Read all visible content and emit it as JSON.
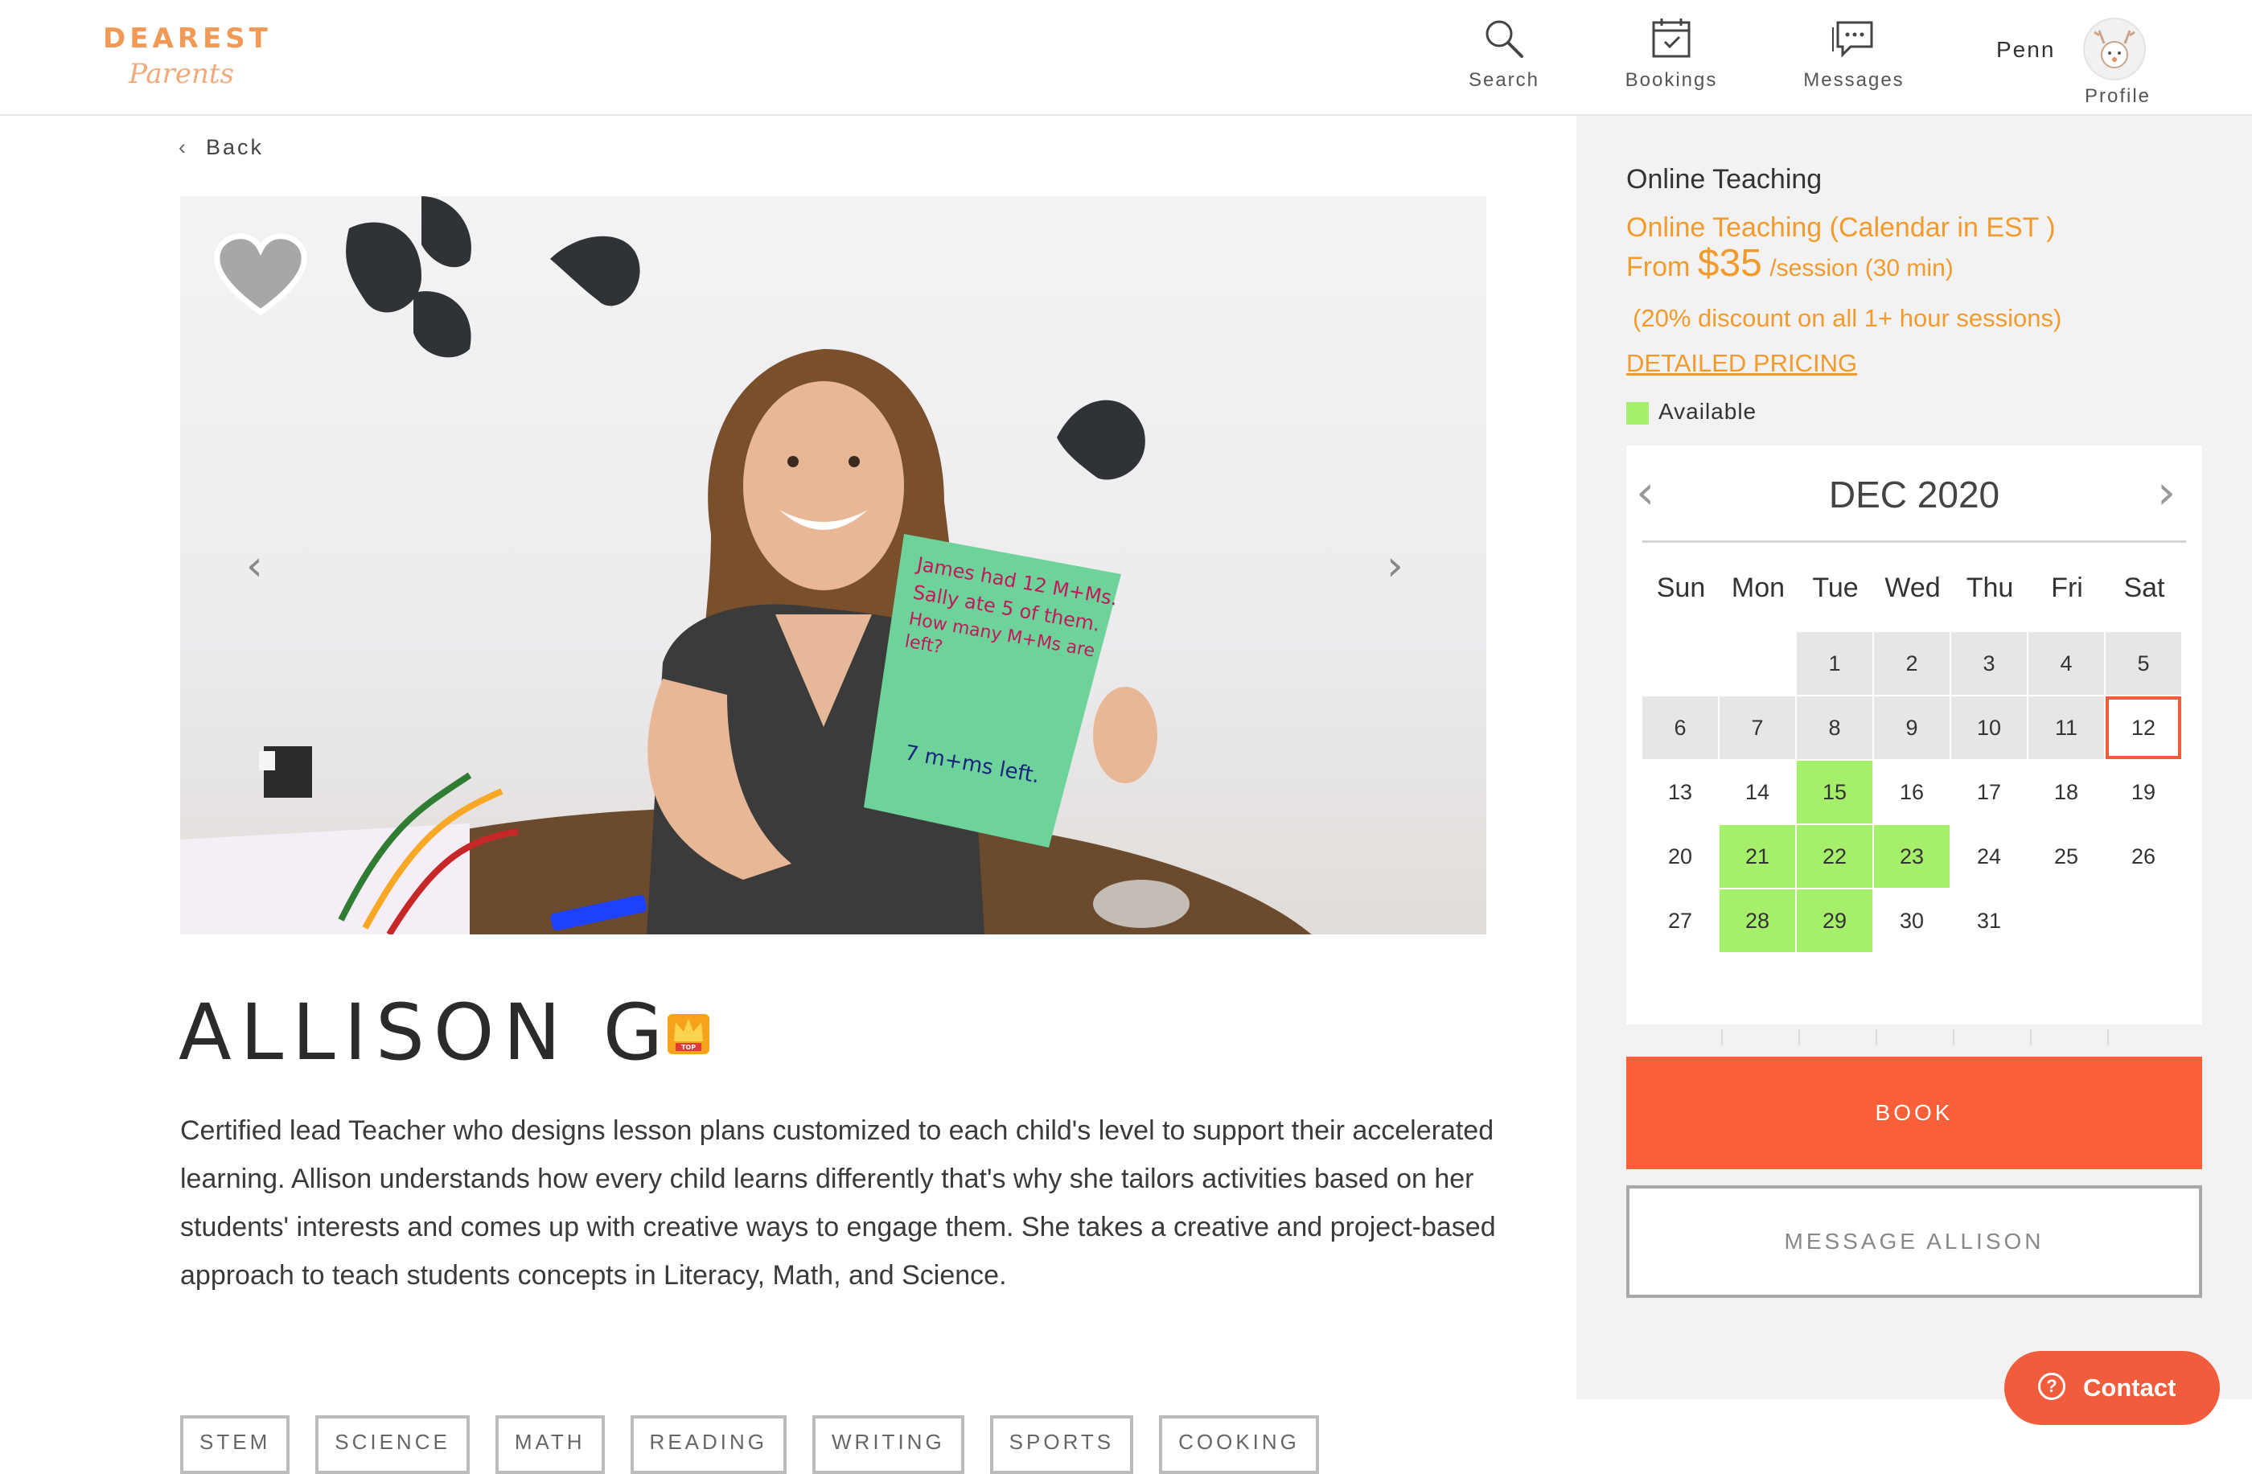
{
  "logo": {
    "top": "DEAREST",
    "bottom": "Parents"
  },
  "nav": {
    "search": "Search",
    "bookings": "Bookings",
    "messages": "Messages",
    "user_name": "Penn",
    "profile": "Profile"
  },
  "back_label": "Back",
  "teacher": {
    "name": "ALLISON G",
    "badge_text": "TOP",
    "bio": "Certified lead Teacher who designs lesson plans customized to each child's level to support their accelerated learning. Allison understands how every child learns differently that's why she tailors activities based on her students' interests and comes up with creative ways to engage them. She takes a creative and project-based approach to teach students concepts in Literacy, Math, and Science.",
    "tags": [
      "STEM",
      "SCIENCE",
      "MATH",
      "READING",
      "WRITING",
      "SPORTS",
      "COOKING"
    ]
  },
  "photo": {
    "card_lines": [
      "James had 12 M+Ms.",
      "Sally ate 5 of them.",
      "How many M+Ms are",
      "left?",
      "7 m+ms left."
    ]
  },
  "booking": {
    "section_title": "Online Teaching",
    "subtitle": "Online Teaching (Calendar in EST )",
    "from_label": "From",
    "price": "$35",
    "per_session": "/session (30 min)",
    "discount": "(20% discount on all 1+ hour sessions)",
    "pricing_link": "DETAILED PRICING",
    "legend_available": "Available",
    "book_label": "BOOK",
    "message_label": "MESSAGE ALLISON"
  },
  "calendar": {
    "month": "DEC 2020",
    "weekdays": [
      "Sun",
      "Mon",
      "Tue",
      "Wed",
      "Thu",
      "Fri",
      "Sat"
    ],
    "first_weekday_index": 2,
    "days_in_month": 31,
    "past_days": [
      1,
      2,
      3,
      4,
      5,
      6,
      7,
      8,
      9,
      10,
      11
    ],
    "today": 12,
    "available_days": [
      15,
      21,
      22,
      23,
      28,
      29
    ]
  },
  "contact_label": "Contact",
  "colors": {
    "accent_orange": "#f9603a",
    "price_orange": "#f39a2c",
    "available_green": "#a6ef6a",
    "today_border": "#f15a3a"
  },
  "icons": {
    "search": "magnifier-icon",
    "bookings": "calendar-icon",
    "messages": "chat-bubble-icon",
    "favorite": "heart-icon",
    "prev": "chevron-left-icon",
    "next": "chevron-right-icon",
    "contact": "question-icon",
    "badge": "crown-icon"
  }
}
